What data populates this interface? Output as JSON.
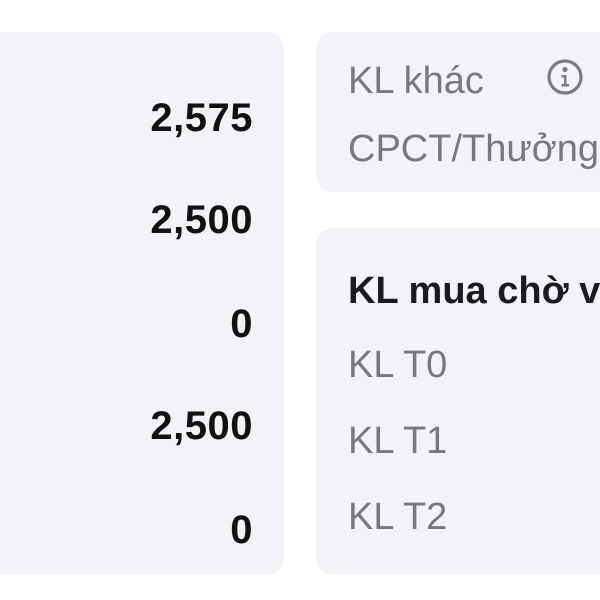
{
  "left_panel": {
    "values": [
      "2,575",
      "2,500",
      "0",
      "2,500",
      "0"
    ]
  },
  "right_top_panel": {
    "title": "KL khác",
    "subtitle": "CPCT/Thưởng",
    "icon": "info-icon"
  },
  "right_bottom_panel": {
    "title": "KL mua chờ về",
    "rows": [
      "KL T0",
      "KL T1",
      "KL T2"
    ]
  }
}
